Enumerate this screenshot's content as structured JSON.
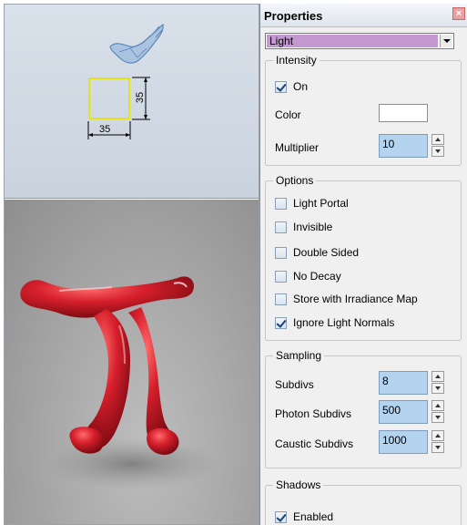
{
  "viewport": {
    "light_width_label": "35",
    "light_height_label": "35"
  },
  "panel": {
    "title": "Properties",
    "close_icon": "close-icon",
    "type_select": {
      "value": "Light",
      "highlight_color": "#c499d2"
    },
    "intensity": {
      "legend": "Intensity",
      "on": {
        "label": "On",
        "checked": true
      },
      "color_label": "Color",
      "color_value": "#ffffff",
      "multiplier_label": "Multiplier",
      "multiplier_value": "10"
    },
    "options": {
      "legend": "Options",
      "items": [
        {
          "label": "Light Portal",
          "checked": false
        },
        {
          "label": "Invisible",
          "checked": false
        },
        {
          "label": "Double Sided",
          "checked": false
        },
        {
          "label": "No Decay",
          "checked": false
        },
        {
          "label": "Store with Irradiance Map",
          "checked": false
        },
        {
          "label": "Ignore Light Normals",
          "checked": true
        }
      ]
    },
    "sampling": {
      "legend": "Sampling",
      "subdivs_label": "Subdivs",
      "subdivs_value": "8",
      "photon_label": "Photon Subdivs",
      "photon_value": "500",
      "caustic_label": "Caustic Subdivs",
      "caustic_value": "1000"
    },
    "shadows": {
      "legend": "Shadows",
      "enabled": {
        "label": "Enabled",
        "checked": true
      }
    }
  },
  "colors": {
    "input_fill": "#b3d3ef",
    "model_red": "#d61f2c",
    "light_outline": "#e6e21a"
  }
}
